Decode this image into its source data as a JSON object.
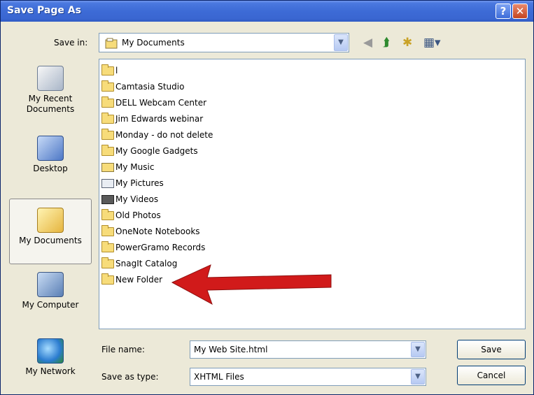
{
  "window": {
    "title": "Save Page As"
  },
  "toolbar": {
    "save_in_label": "Save in:",
    "save_in_value": "My Documents",
    "nav_icons": [
      "back-icon",
      "up-folder-icon",
      "new-folder-icon",
      "views-menu-icon"
    ]
  },
  "places": [
    {
      "label": "My Recent Documents",
      "icon": "recent-documents-icon"
    },
    {
      "label": "Desktop",
      "icon": "desktop-icon"
    },
    {
      "label": "My Documents",
      "icon": "my-documents-icon",
      "selected": true
    },
    {
      "label": "My Computer",
      "icon": "computer-icon"
    },
    {
      "label": "My Network",
      "icon": "network-icon"
    }
  ],
  "files": [
    {
      "name": "l",
      "type": "folder"
    },
    {
      "name": "Camtasia Studio",
      "type": "folder"
    },
    {
      "name": "DELL Webcam Center",
      "type": "folder"
    },
    {
      "name": "Jim Edwards webinar",
      "type": "folder"
    },
    {
      "name": "Monday - do not delete",
      "type": "folder"
    },
    {
      "name": "My Google Gadgets",
      "type": "folder"
    },
    {
      "name": "My Music",
      "type": "music"
    },
    {
      "name": "My Pictures",
      "type": "pictures"
    },
    {
      "name": "My Videos",
      "type": "videos"
    },
    {
      "name": "Old Photos",
      "type": "folder"
    },
    {
      "name": "OneNote Notebooks",
      "type": "folder"
    },
    {
      "name": "PowerGramo Records",
      "type": "folder"
    },
    {
      "name": "SnagIt Catalog",
      "type": "folder"
    },
    {
      "name": "New Folder",
      "type": "folder"
    }
  ],
  "annotation": {
    "arrow_color": "#d11a1a",
    "arrow_target": "New Folder"
  },
  "form": {
    "file_name_label": "File name:",
    "file_name_value": "My Web Site.html",
    "save_as_type_label": "Save as type:",
    "save_as_type_value": "XHTML Files"
  },
  "buttons": {
    "save": "Save",
    "cancel": "Cancel"
  },
  "colors": {
    "titlebar": "#3d6bd6",
    "dialog_bg": "#ece9d8",
    "field_border": "#7f9db9"
  }
}
